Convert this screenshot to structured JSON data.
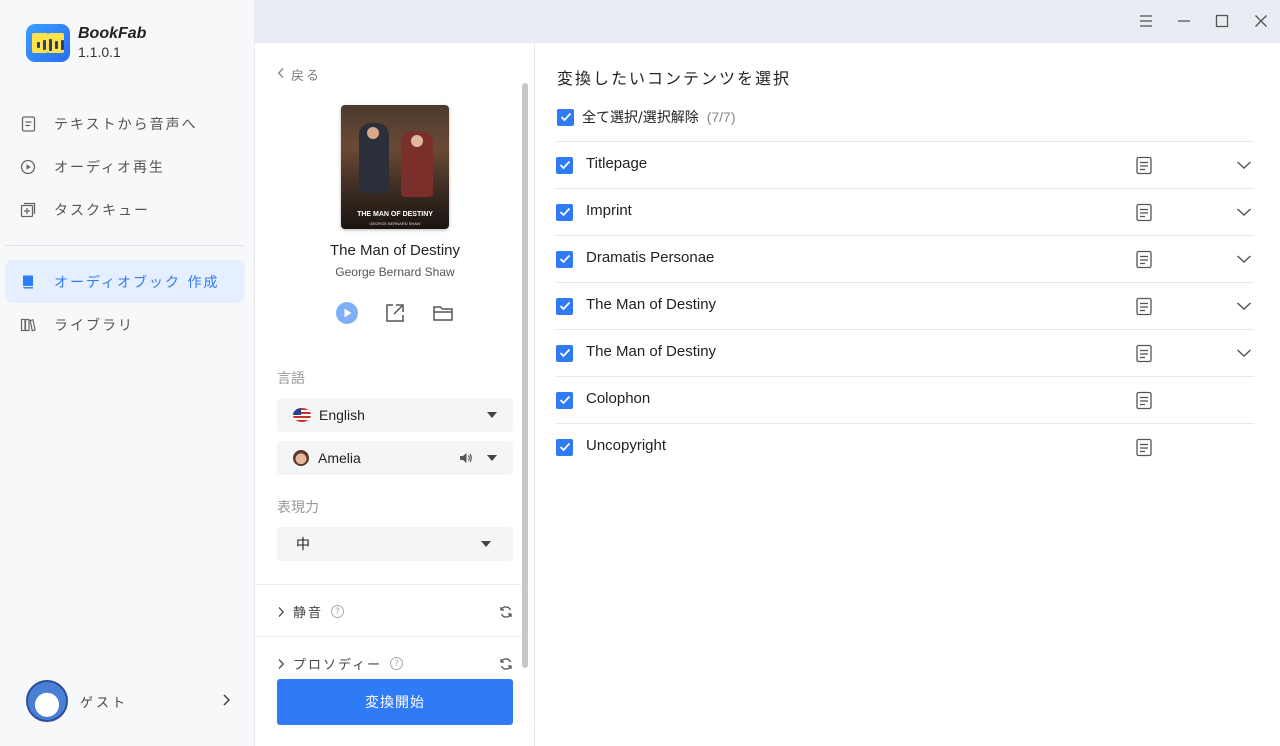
{
  "app": {
    "name": "BookFab",
    "version": "1.1.0.1"
  },
  "sidebar": {
    "items": [
      {
        "label": "テキストから音声へ",
        "icon": "document-icon"
      },
      {
        "label": "オーディオ再生",
        "icon": "play-circle-icon"
      },
      {
        "label": "タスクキュー",
        "icon": "task-queue-icon"
      },
      {
        "label": "オーディオブック 作成",
        "icon": "book-icon",
        "active": true
      },
      {
        "label": "ライブラリ",
        "icon": "library-icon"
      }
    ],
    "user": {
      "name": "ゲスト"
    }
  },
  "panel": {
    "back_label": "戻る",
    "book": {
      "title": "The Man of Destiny",
      "author": "George Bernard Shaw",
      "cover_title": "THE MAN OF DESTINY",
      "cover_author": "GEORGE BERNARD SHAW"
    },
    "language_label": "言語",
    "language_value": "English",
    "voice_value": "Amelia",
    "expression_label": "表現力",
    "expression_value": "中",
    "silence_label": "静音",
    "prosody_label": "プロソディー",
    "start_button": "変換開始"
  },
  "content": {
    "title": "変換したいコンテンツを選択",
    "select_all_label": "全て選択/選択解除",
    "select_all_count": "(7/7)",
    "chapters": [
      {
        "name": "Titlepage",
        "expandable": true
      },
      {
        "name": "Imprint",
        "expandable": true
      },
      {
        "name": "Dramatis Personae",
        "expandable": true
      },
      {
        "name": "The Man of Destiny",
        "expandable": true
      },
      {
        "name": "The Man of Destiny",
        "expandable": true
      },
      {
        "name": "Colophon",
        "expandable": false
      },
      {
        "name": "Uncopyright",
        "expandable": false
      }
    ]
  },
  "colors": {
    "accent": "#2f7bf5",
    "active_bg": "#e6efff"
  }
}
